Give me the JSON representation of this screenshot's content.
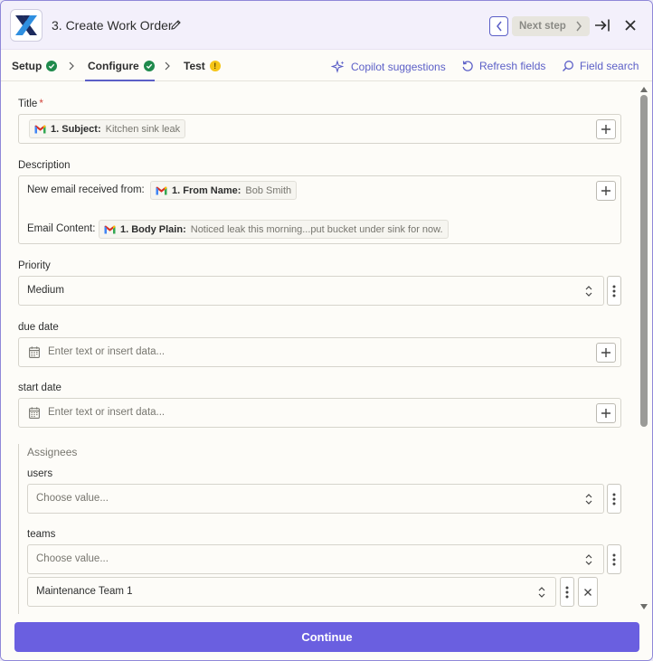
{
  "header": {
    "title": "3. Create Work Order",
    "next_step_label": "Next step",
    "icons": [
      "app-logo-icon",
      "pencil-icon",
      "chevron-left-icon",
      "chevron-right-icon",
      "skip-to-end-icon",
      "close-icon"
    ]
  },
  "tabs": [
    {
      "label": "Setup",
      "status": "complete"
    },
    {
      "label": "Configure",
      "status": "complete",
      "active": true
    },
    {
      "label": "Test",
      "status": "warning"
    }
  ],
  "toolbar": {
    "copilot_label": "Copilot suggestions",
    "refresh_label": "Refresh fields",
    "search_label": "Field search"
  },
  "form": {
    "title": {
      "label": "Title",
      "required_mark": "*",
      "pill": {
        "key": "1. Subject:",
        "value": "Kitchen sink leak"
      }
    },
    "description": {
      "label": "Description",
      "line1_text": "New email received from:",
      "line1_pill": {
        "key": "1. From Name:",
        "value": "Bob Smith"
      },
      "line2_text": "Email Content:",
      "line2_pill": {
        "key": "1. Body Plain:",
        "value": "Noticed leak this morning...put bucket under sink for now."
      }
    },
    "priority": {
      "label": "Priority",
      "value": "Medium"
    },
    "due_date": {
      "label": "due date",
      "placeholder": "Enter text or insert data..."
    },
    "start_date": {
      "label": "start date",
      "placeholder": "Enter text or insert data..."
    },
    "assignees": {
      "group_label": "Assignees",
      "users": {
        "label": "users",
        "placeholder": "Choose value..."
      },
      "teams": {
        "label": "teams",
        "placeholder": "Choose value...",
        "selected": "Maintenance Team 1"
      }
    }
  },
  "footer": {
    "continue_label": "Continue"
  },
  "colors": {
    "accent": "#5b5fc7",
    "continue_button": "#6a5fe0",
    "success": "#1f8a4c",
    "warning": "#f5c518",
    "required": "#d2443b"
  }
}
